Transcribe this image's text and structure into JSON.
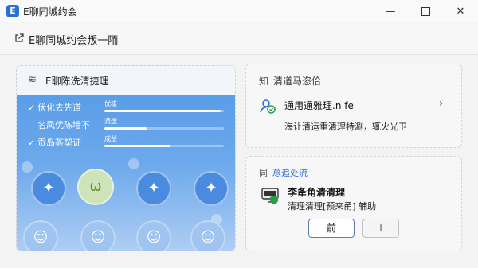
{
  "window": {
    "app_icon_letter": "E",
    "title": "E聊同城约会",
    "controls": {
      "minimize": "—",
      "close": "✕"
    }
  },
  "page": {
    "title": "E聊同城约会叛一陑"
  },
  "left_panel": {
    "title": "E聊陈洗清捷理",
    "features": [
      {
        "check": "✓",
        "label": "伏化去先道"
      },
      {
        "check": "",
        "label": "名凤优陈墙不"
      },
      {
        "check": "✓",
        "label": "贡岛荟契证"
      }
    ],
    "bars": [
      {
        "label": "优雄",
        "progress": 0.97
      },
      {
        "label": "滴途",
        "progress": 0.35
      },
      {
        "label": "成益",
        "progress": 0.55
      }
    ]
  },
  "card1": {
    "header_icon": "知",
    "header": "清道马恣佮",
    "item_name": "通用通雅理.n fe",
    "item_desc": "海让清运重清理特涮，辄火光卫",
    "arrow": "›"
  },
  "card2": {
    "header_icon": "同",
    "header": "荩追处流",
    "item_name": "李夅角清清理",
    "item_desc": "清理清理[预来甬] 辅助",
    "prev_label": "前",
    "next_label": "I"
  },
  "colors": {
    "accent": "#2b6fd6",
    "banner": "#5a9de8",
    "selected_avatar": "#cfe3b8"
  }
}
